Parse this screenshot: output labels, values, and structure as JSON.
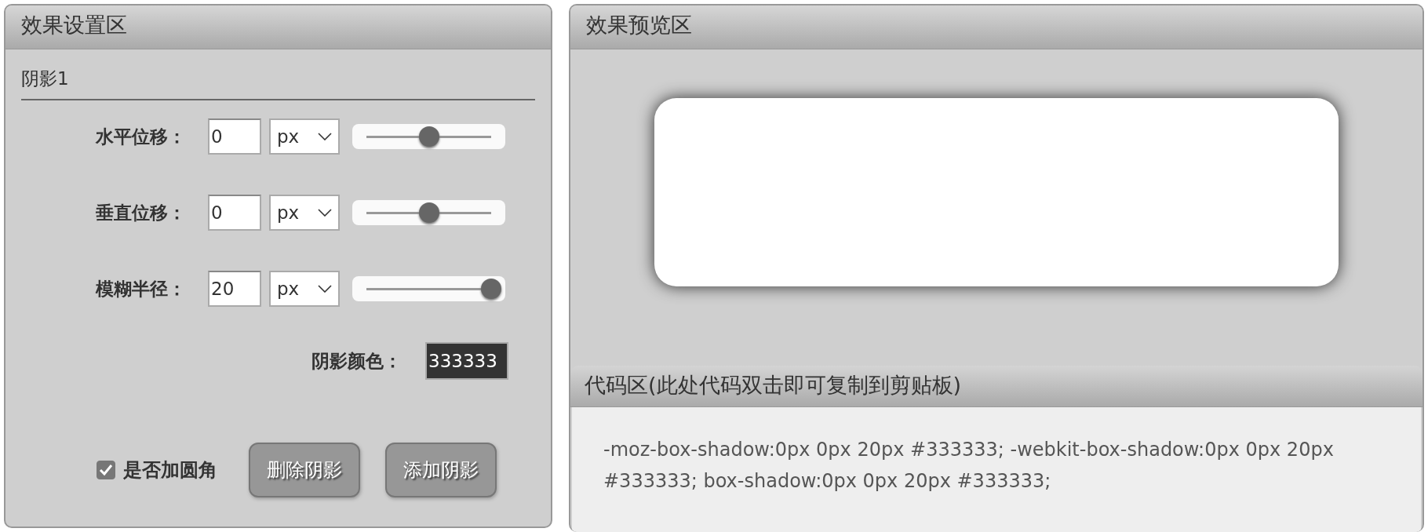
{
  "settings_panel": {
    "title": "效果设置区",
    "section_title": "阴影1",
    "rows": [
      {
        "label": "水平位移：",
        "value": "0",
        "unit": "px",
        "level": 0.5
      },
      {
        "label": "垂直位移：",
        "value": "0",
        "unit": "px",
        "level": 0.5
      },
      {
        "label": "模糊半径：",
        "value": "20",
        "unit": "px",
        "level": 1.0
      }
    ],
    "color_row": {
      "label": "阴影颜色：",
      "value": "333333"
    },
    "rounded_checkbox": {
      "label": "是否加圆角",
      "checked": true
    },
    "buttons": [
      "删除阴影",
      "添加阴影"
    ]
  },
  "preview_panel": {
    "title": "效果预览区"
  },
  "code_panel": {
    "title": "代码区(此处代码双击即可复制到剪贴板)",
    "code": "-moz-box-shadow:0px 0px 20px #333333; -webkit-box-shadow:0px 0px 20px #333333; box-shadow:0px 0px 20px #333333;"
  }
}
